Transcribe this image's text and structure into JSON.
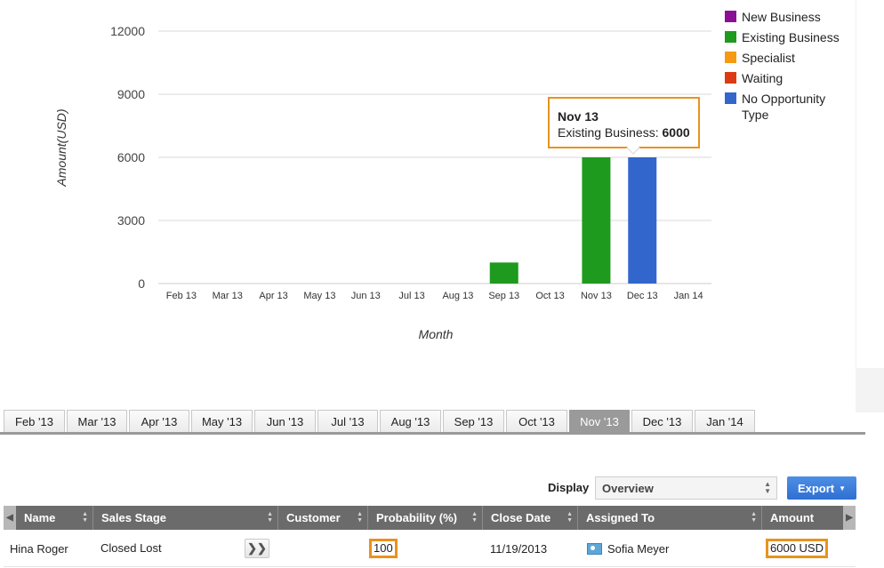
{
  "chart_data": {
    "type": "bar",
    "title": "",
    "xlabel": "Month",
    "ylabel": "Amount(USD)",
    "ylim": [
      0,
      12000
    ],
    "yticks": [
      0,
      3000,
      6000,
      9000,
      12000
    ],
    "grid": true,
    "legend_position": "right",
    "categories": [
      "Feb 13",
      "Mar 13",
      "Apr 13",
      "May 13",
      "Jun 13",
      "Jul 13",
      "Aug 13",
      "Sep 13",
      "Oct 13",
      "Nov 13",
      "Dec 13",
      "Jan 14"
    ],
    "series": [
      {
        "name": "New Business",
        "color": "#8b0f96",
        "values": [
          0,
          0,
          0,
          0,
          0,
          0,
          0,
          0,
          0,
          0,
          0,
          0
        ]
      },
      {
        "name": "Existing Business",
        "color": "#1e9a1e",
        "values": [
          0,
          0,
          0,
          0,
          0,
          0,
          0,
          1000,
          0,
          6000,
          0,
          0
        ]
      },
      {
        "name": "Specialist",
        "color": "#f59a12",
        "values": [
          0,
          0,
          0,
          0,
          0,
          0,
          0,
          0,
          0,
          0,
          0,
          0
        ]
      },
      {
        "name": "Waiting",
        "color": "#dc3a12",
        "values": [
          0,
          0,
          0,
          0,
          0,
          0,
          0,
          0,
          0,
          0,
          0,
          0
        ]
      },
      {
        "name": "No Opportunity Type",
        "color": "#3366cc",
        "values": [
          0,
          0,
          0,
          0,
          0,
          0,
          0,
          0,
          0,
          0,
          6000,
          0
        ]
      }
    ]
  },
  "legend": [
    {
      "label": "New Business",
      "color": "#8b0f96"
    },
    {
      "label": "Existing Business",
      "color": "#1e9a1e"
    },
    {
      "label": "Specialist",
      "color": "#f59a12"
    },
    {
      "label": "Waiting",
      "color": "#dc3a12"
    },
    {
      "label": "No Opportunity Type",
      "color": "#3366cc"
    }
  ],
  "tooltip": {
    "title": "Nov 13",
    "series_label": "Existing Business: ",
    "value": "6000"
  },
  "month_tabs": [
    "Feb '13",
    "Mar '13",
    "Apr '13",
    "May '13",
    "Jun '13",
    "Jul '13",
    "Aug '13",
    "Sep '13",
    "Oct '13",
    "Nov '13",
    "Dec '13",
    "Jan '14"
  ],
  "active_tab": "Nov '13",
  "toolbar": {
    "display_label": "Display",
    "display_value": "Overview",
    "export_label": "Export"
  },
  "grid": {
    "columns": [
      "Name",
      "Sales Stage",
      "Customer",
      "Probability (%)",
      "Close Date",
      "Assigned To",
      "Amount"
    ],
    "rows": [
      {
        "name": "Hina Roger",
        "sales_stage": "Closed Lost",
        "more": "❯❯",
        "customer": "",
        "probability": "100",
        "close_date": "11/19/2013",
        "assigned_to": "Sofia Meyer",
        "amount": "6000 USD"
      }
    ]
  },
  "colors": {
    "highlight": "#e8931d",
    "header_bg": "#6b6b6b",
    "active_tab": "#9a9a9a",
    "export_button": "#3a7bdc"
  }
}
